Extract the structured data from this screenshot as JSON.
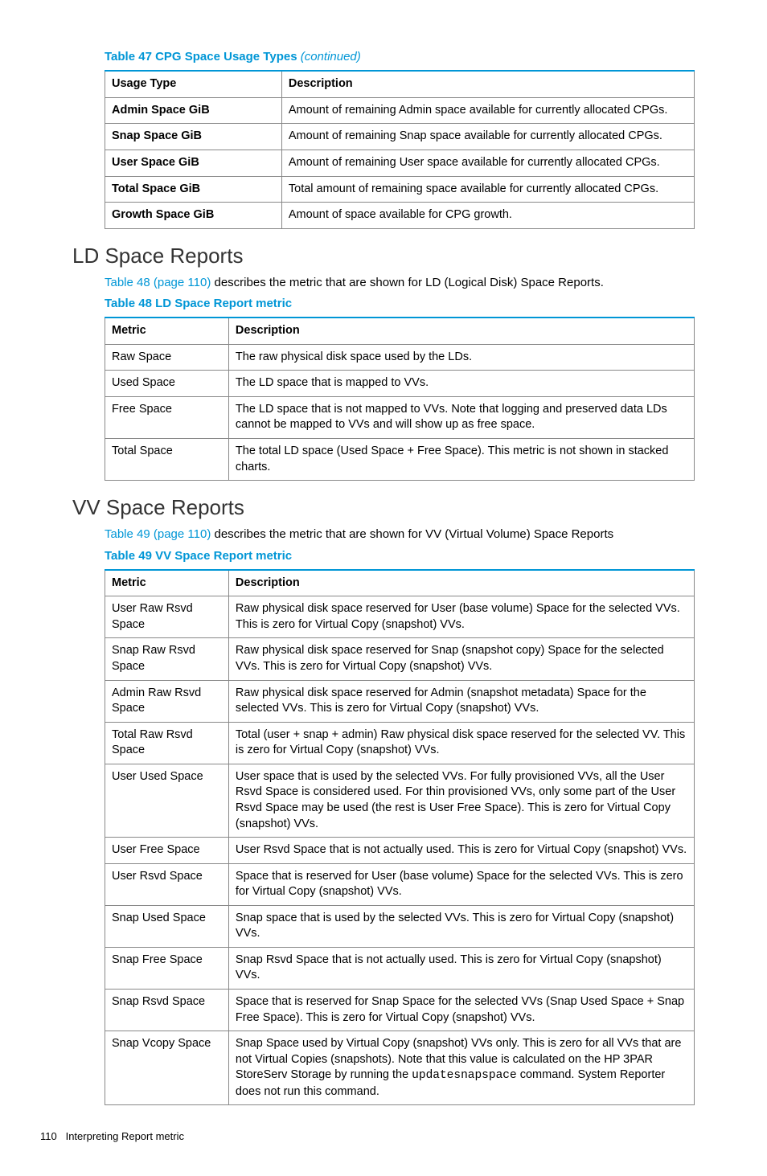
{
  "table47": {
    "caption": "Table 47 CPG Space Usage Types",
    "continued": "(continued)",
    "headers": [
      "Usage Type",
      "Description"
    ],
    "rows": [
      [
        "Admin Space GiB",
        "Amount of remaining Admin space available for currently allocated CPGs."
      ],
      [
        "Snap Space GiB",
        "Amount of remaining Snap space available for currently allocated CPGs."
      ],
      [
        "User Space GiB",
        "Amount of remaining User space available for currently allocated CPGs."
      ],
      [
        "Total Space GiB",
        "Total amount of remaining space available for currently allocated CPGs."
      ],
      [
        "Growth Space GiB",
        "Amount of space available for CPG growth."
      ]
    ]
  },
  "ld": {
    "heading": "LD Space Reports",
    "intro_link": "Table 48 (page 110)",
    "intro_rest": " describes the metric that are shown for LD (Logical Disk) Space Reports.",
    "caption": "Table 48 LD Space Report metric",
    "headers": [
      "Metric",
      "Description"
    ],
    "rows": [
      [
        "Raw Space",
        "The raw physical disk space used by the LDs."
      ],
      [
        "Used Space",
        "The LD space that is mapped to VVs."
      ],
      [
        "Free Space",
        "The LD space that is not mapped to VVs. Note that logging and preserved data LDs cannot be mapped to VVs and will show up as free space."
      ],
      [
        "Total Space",
        "The total LD space (Used Space + Free Space). This metric is not shown in stacked charts."
      ]
    ]
  },
  "vv": {
    "heading": "VV Space Reports",
    "intro_link": "Table 49 (page 110)",
    "intro_rest": " describes the metric that are shown for VV (Virtual Volume) Space Reports",
    "caption": "Table 49 VV Space Report metric",
    "headers": [
      "Metric",
      "Description"
    ],
    "rows": [
      [
        "User Raw Rsvd Space",
        "Raw physical disk space reserved for User (base volume) Space for the selected VVs. This is zero for Virtual Copy (snapshot) VVs."
      ],
      [
        "Snap Raw Rsvd Space",
        "Raw physical disk space reserved for Snap (snapshot copy) Space for the selected VVs. This is zero for Virtual Copy (snapshot) VVs."
      ],
      [
        "Admin Raw Rsvd Space",
        "Raw physical disk space reserved for Admin (snapshot metadata) Space for the selected VVs. This is zero for Virtual Copy (snapshot) VVs."
      ],
      [
        "Total Raw Rsvd Space",
        "Total (user + snap + admin) Raw physical disk space reserved for the selected VV. This is zero for Virtual Copy (snapshot) VVs."
      ],
      [
        "User Used Space",
        "User space that is used by the selected VVs. For fully provisioned VVs, all the User Rsvd Space is considered used. For thin provisioned VVs, only some part of the User Rsvd Space may be used (the rest is User Free Space). This is zero for Virtual Copy (snapshot) VVs."
      ],
      [
        "User Free Space",
        "User Rsvd Space that is not actually used. This is zero for Virtual Copy (snapshot) VVs."
      ],
      [
        "User Rsvd Space",
        "Space that is reserved for User (base volume) Space for the selected VVs. This is zero for Virtual Copy (snapshot) VVs."
      ],
      [
        "Snap Used Space",
        "Snap space that is used by the selected VVs. This is zero for Virtual Copy (snapshot) VVs."
      ],
      [
        "Snap Free Space",
        "Snap Rsvd Space that is not actually used. This is zero for Virtual Copy (snapshot) VVs."
      ],
      [
        "Snap Rsvd Space",
        "Space that is reserved for Snap Space for the selected VVs (Snap Used Space + Snap Free Space). This is zero for Virtual Copy (snapshot) VVs."
      ]
    ],
    "vcopy_metric": "Snap Vcopy Space",
    "vcopy_pre": "Snap Space used by Virtual Copy (snapshot) VVs only. This is zero for all VVs that are not Virtual Copies (snapshots). Note that this value is calculated on the HP 3PAR StoreServ Storage by running the ",
    "vcopy_cmd": "updatesnapspace",
    "vcopy_post": " command. System Reporter does not run this command."
  },
  "footer": {
    "page": "110",
    "title": "Interpreting Report metric"
  }
}
